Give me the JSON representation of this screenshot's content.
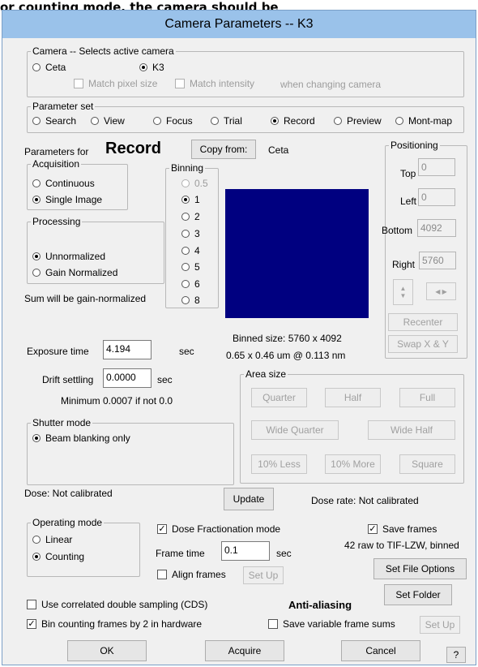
{
  "caption": "or counting mode, the camera should be",
  "dialog_title": "Camera Parameters  --  K3",
  "camera": {
    "legend": "Camera -- Selects active camera",
    "options": [
      "Ceta",
      "K3"
    ],
    "selected": "K3",
    "match_pixel": "Match pixel size",
    "match_intensity": "Match intensity",
    "when_changing": "when changing camera"
  },
  "param_set": {
    "legend": "Parameter set",
    "options": [
      "Search",
      "View",
      "Focus",
      "Trial",
      "Record",
      "Preview",
      "Mont-map"
    ],
    "selected": "Record"
  },
  "params_for_label": "Parameters for",
  "params_for_value": "Record",
  "copy_from_label": "Copy from:",
  "copy_from_value": "Ceta",
  "acquisition": {
    "legend": "Acquisition",
    "options": [
      "Continuous",
      "Single Image"
    ],
    "selected": "Single Image"
  },
  "binning": {
    "legend": "Binning",
    "options": [
      "0.5",
      "1",
      "2",
      "3",
      "4",
      "5",
      "6",
      "8"
    ],
    "selected": "1"
  },
  "processing": {
    "legend": "Processing",
    "options": [
      "Unnormalized",
      "Gain Normalized"
    ],
    "selected": "Unnormalized"
  },
  "sum_note": "Sum will be gain-normalized",
  "preview_color": "#000080",
  "positioning": {
    "legend": "Positioning",
    "top_label": "Top",
    "top_value": "0",
    "left_label": "Left",
    "left_value": "0",
    "bottom_label": "Bottom",
    "bottom_value": "4092",
    "right_label": "Right",
    "right_value": "5760",
    "recenter": "Recenter",
    "swap": "Swap X & Y"
  },
  "binned_size": "Binned size: 5760 x 4092",
  "pixel_info": "0.65 x 0.46 um @ 0.113 nm",
  "exposure": {
    "label": "Exposure time",
    "value": "4.194",
    "unit": "sec"
  },
  "drift": {
    "label": "Drift settling",
    "value": "0.0000",
    "unit": "sec",
    "minimum": "Minimum 0.0007 if not 0.0"
  },
  "area_size": {
    "legend": "Area size",
    "buttons": [
      "Quarter",
      "Half",
      "Full",
      "Wide Quarter",
      "Wide Half",
      "10% Less",
      "10% More",
      "Square"
    ]
  },
  "shutter": {
    "legend": "Shutter mode",
    "option": "Beam blanking only"
  },
  "dose": "Dose: Not calibrated",
  "update": "Update",
  "dose_rate": "Dose rate: Not calibrated",
  "operating": {
    "legend": "Operating mode",
    "options": [
      "Linear",
      "Counting"
    ],
    "selected": "Counting"
  },
  "dose_frac": {
    "label": "Dose Fractionation mode",
    "checked": true
  },
  "frame_time": {
    "label": "Frame time",
    "value": "0.1",
    "unit": "sec"
  },
  "align_frames": {
    "label": "Align frames",
    "checked": false,
    "setup": "Set Up"
  },
  "save_frames": {
    "label": "Save frames",
    "checked": true,
    "info": "42 raw to TIF-LZW, binned"
  },
  "set_file_options": "Set File Options",
  "set_folder": "Set Folder",
  "cds": {
    "label": "Use correlated double sampling (CDS)",
    "checked": false
  },
  "bin_counting": {
    "label": "Bin counting frames by 2 in hardware",
    "checked": true
  },
  "anti_aliasing": "Anti-aliasing",
  "save_variable": {
    "label": "Save variable frame sums",
    "checked": false,
    "setup": "Set Up"
  },
  "footer": {
    "ok": "OK",
    "acquire": "Acquire",
    "cancel": "Cancel",
    "help": "?"
  }
}
